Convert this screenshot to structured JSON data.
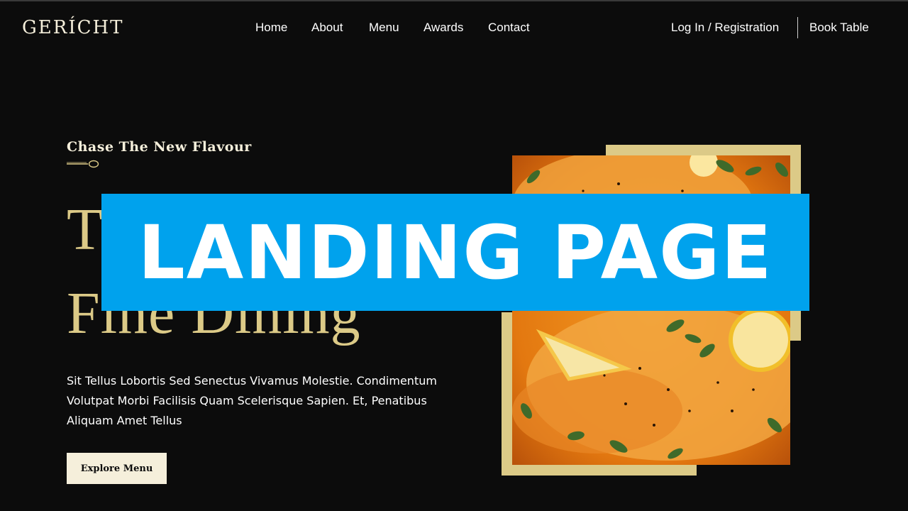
{
  "brand": {
    "logo": "GERÍCHT"
  },
  "nav": {
    "links": [
      "Home",
      "About",
      "Menu",
      "Awards",
      "Contact"
    ],
    "login": "Log In / Registration",
    "book": "Book Table"
  },
  "hero": {
    "subtitle": "Chase The New Flavour",
    "title_line1": "T",
    "title_line2": "Fine Dining",
    "description": "Sit Tellus Lobortis Sed Senectus Vivamus Molestie. Condimentum Volutpat Morbi Facilisis Quam Scelerisque Sapien. Et, Penatibus Aliquam Amet Tellus",
    "button": "Explore Menu"
  },
  "banner": {
    "text": "LANDING PAGE"
  },
  "colors": {
    "background": "#0c0c0c",
    "gold": "#dcca87",
    "cream": "#f5efdb",
    "banner": "#00a2ed"
  },
  "icons": {
    "divider": "spoon-icon",
    "image": "salmon-dish-photo"
  }
}
